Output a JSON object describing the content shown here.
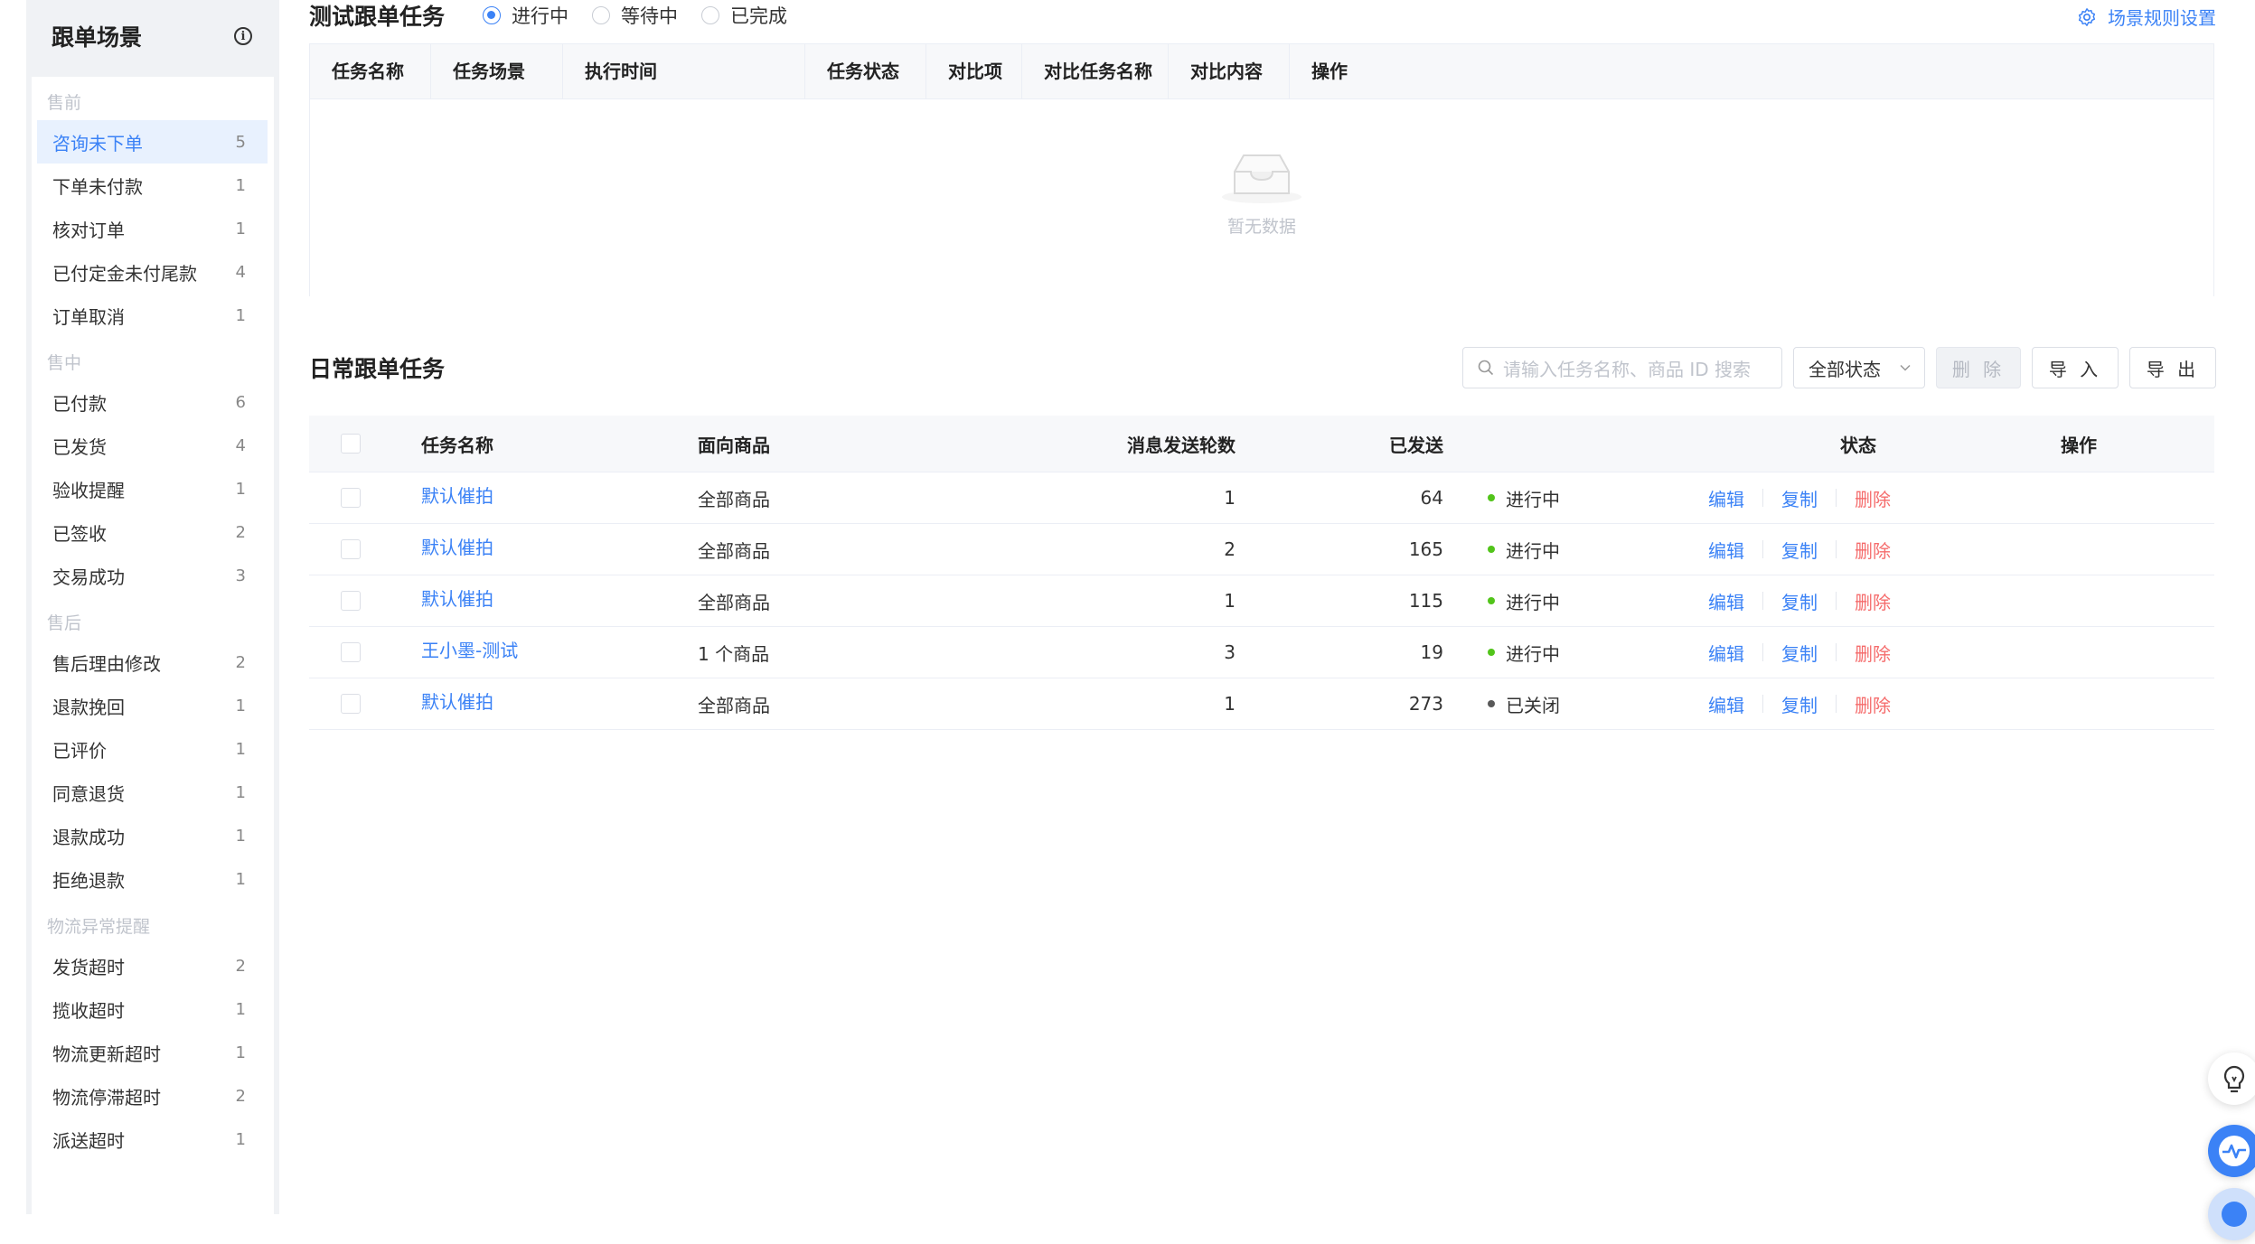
{
  "sidebar": {
    "title": "跟单场景",
    "groups": [
      {
        "label": "售前",
        "items": [
          {
            "label": "咨询未下单",
            "count": "5",
            "active": true
          },
          {
            "label": "下单未付款",
            "count": "1"
          },
          {
            "label": "核对订单",
            "count": "1"
          },
          {
            "label": "已付定金未付尾款",
            "count": "4"
          },
          {
            "label": "订单取消",
            "count": "1"
          }
        ]
      },
      {
        "label": "售中",
        "items": [
          {
            "label": "已付款",
            "count": "6"
          },
          {
            "label": "已发货",
            "count": "4"
          },
          {
            "label": "验收提醒",
            "count": "1"
          },
          {
            "label": "已签收",
            "count": "2"
          },
          {
            "label": "交易成功",
            "count": "3"
          }
        ]
      },
      {
        "label": "售后",
        "items": [
          {
            "label": "售后理由修改",
            "count": "2"
          },
          {
            "label": "退款挽回",
            "count": "1"
          },
          {
            "label": "已评价",
            "count": "1"
          },
          {
            "label": "同意退货",
            "count": "1"
          },
          {
            "label": "退款成功",
            "count": "1"
          },
          {
            "label": "拒绝退款",
            "count": "1"
          }
        ]
      },
      {
        "label": "物流异常提醒",
        "items": [
          {
            "label": "发货超时",
            "count": "2"
          },
          {
            "label": "揽收超时",
            "count": "1"
          },
          {
            "label": "物流更新超时",
            "count": "1"
          },
          {
            "label": "物流停滞超时",
            "count": "2"
          },
          {
            "label": "派送超时",
            "count": "1"
          }
        ]
      }
    ]
  },
  "test_section": {
    "title": "测试跟单任务",
    "filters": [
      {
        "label": "进行中",
        "checked": true
      },
      {
        "label": "等待中",
        "checked": false
      },
      {
        "label": "已完成",
        "checked": false
      }
    ],
    "settings_link": "场景规则设置",
    "columns": [
      "任务名称",
      "任务场景",
      "执行时间",
      "任务状态",
      "对比项",
      "对比任务名称",
      "对比内容",
      "操作"
    ],
    "empty_text": "暂无数据"
  },
  "daily_section": {
    "title": "日常跟单任务",
    "search_placeholder": "请输入任务名称、商品 ID 搜索",
    "status_select": "全部状态",
    "delete_button": "删 除",
    "import_button": "导 入",
    "export_button": "导 出",
    "columns": [
      "任务名称",
      "面向商品",
      "消息发送轮数",
      "已发送",
      "状态",
      "操作"
    ],
    "actions": [
      "编辑",
      "复制",
      "删除"
    ],
    "rows": [
      {
        "name": "默认催拍",
        "product": "全部商品",
        "rounds": "1",
        "sent": "64",
        "status": "进行中",
        "status_color": "#52c41a"
      },
      {
        "name": "默认催拍",
        "product": "全部商品",
        "rounds": "2",
        "sent": "165",
        "status": "进行中",
        "status_color": "#52c41a"
      },
      {
        "name": "默认催拍",
        "product": "全部商品",
        "rounds": "1",
        "sent": "115",
        "status": "进行中",
        "status_color": "#52c41a"
      },
      {
        "name": "王小墨-测试",
        "product": "1 个商品",
        "rounds": "3",
        "sent": "19",
        "status": "进行中",
        "status_color": "#52c41a"
      },
      {
        "name": "默认催拍",
        "product": "全部商品",
        "rounds": "1",
        "sent": "273",
        "status": "已关闭",
        "status_color": "#595959"
      }
    ]
  },
  "colors": {
    "accent": "#3b82f6",
    "danger": "#f56c6c",
    "running": "#52c41a",
    "closed": "#595959"
  }
}
